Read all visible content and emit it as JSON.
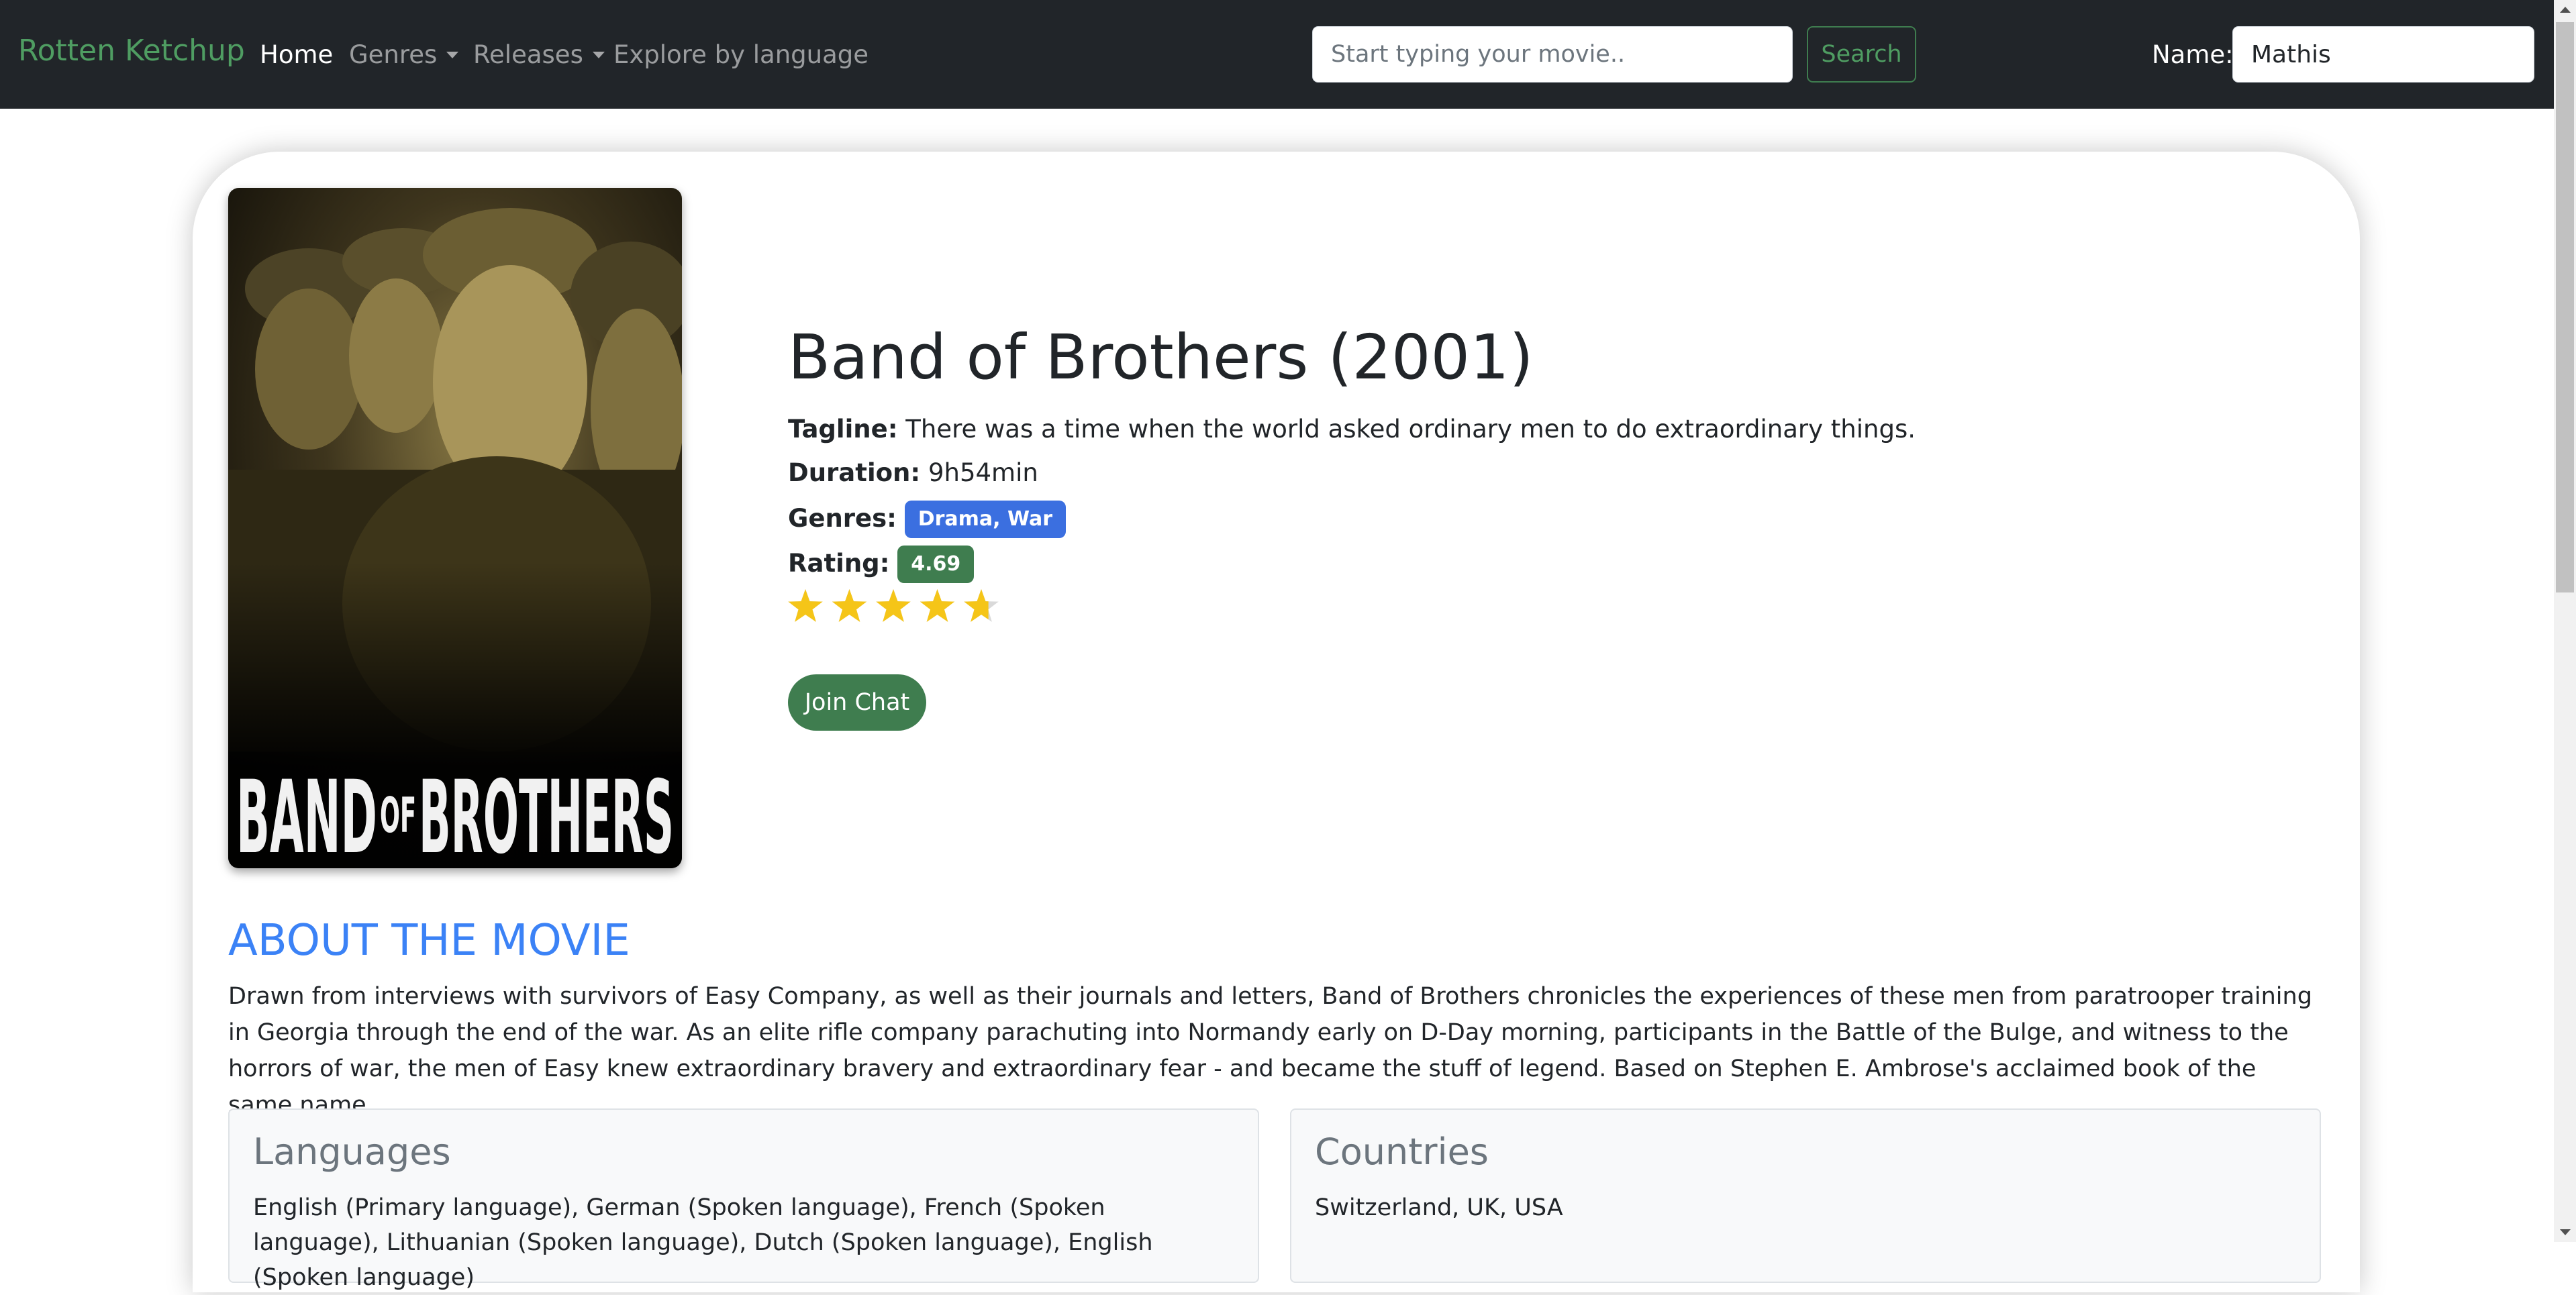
{
  "navbar": {
    "brand": "Rotten Ketchup",
    "links": [
      {
        "label": "Home"
      },
      {
        "label": "Genres"
      },
      {
        "label": "Releases"
      },
      {
        "label": "Explore by language"
      }
    ],
    "search_placeholder": "Start typing your movie..",
    "search_button": "Search",
    "name_label": "Name:",
    "name_value": "Mathis"
  },
  "movie": {
    "poster_text_1": "BAND",
    "poster_text_2": "OF",
    "poster_text_3": "BROTHERS",
    "title": "Band of Brothers (2001)",
    "tagline_label": "Tagline:",
    "tagline": "There was a time when the world asked ordinary men to do extraordinary things.",
    "duration_label": "Duration:",
    "duration": "9h54min",
    "genres_label": "Genres:",
    "genres": "Drama, War",
    "rating_label": "Rating:",
    "rating": "4.69",
    "stars_max": 5,
    "join_button": "Join Chat"
  },
  "about": {
    "heading": "ABOUT THE MOVIE",
    "text": "Drawn from interviews with survivors of Easy Company, as well as their journals and letters, Band of Brothers chronicles the experiences of these men from paratrooper training in Georgia through the end of the war. As an elite rifle company parachuting into Normandy early on D-Day morning, participants in the Battle of the Bulge, and witness to the horrors of war, the men of Easy knew extraordinary bravery and extraordinary fear - and became the stuff of legend. Based on Stephen E. Ambrose's acclaimed book of the same name."
  },
  "languages": {
    "title": "Languages",
    "text": "English (Primary language), German (Spoken language), French (Spoken language), Lithuanian (Spoken language), Dutch (Spoken language), English (Spoken language)"
  },
  "countries": {
    "title": "Countries",
    "text": "Switzerland, UK, USA"
  },
  "colors": {
    "navbar_bg": "#212529",
    "brand_green": "#4f9d62",
    "genre_badge": "#3b6fe0",
    "rating_badge": "#3f7d4f",
    "heading_blue": "#3b82f6",
    "star_gold": "#f5c518"
  },
  "icons": {
    "dropdown": "chevron-down-icon",
    "rating": "star-icon"
  }
}
